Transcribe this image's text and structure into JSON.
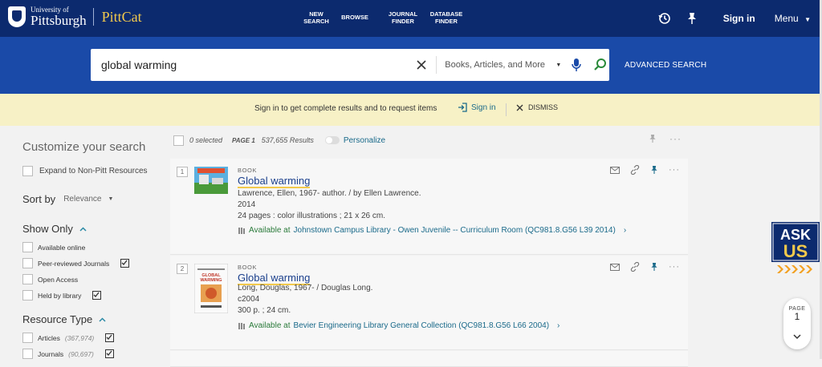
{
  "header": {
    "university_line1": "University of",
    "university_line2": "Pittsburgh",
    "app_name": "PittCat",
    "nav": [
      {
        "l1": "NEW",
        "l2": "SEARCH"
      },
      {
        "l1": "BROWSE",
        "l2": ""
      },
      {
        "l1": "JOURNAL",
        "l2": "FINDER"
      },
      {
        "l1": "DATABASE",
        "l2": "FINDER"
      }
    ],
    "sign_in": "Sign in",
    "menu": "Menu",
    "icons": [
      "history-icon",
      "pin-icon"
    ]
  },
  "search": {
    "query": "global warming",
    "scope": "Books, Articles, and More",
    "advanced": "ADVANCED SEARCH"
  },
  "banner": {
    "text": "Sign in to get complete results and to request items",
    "signin": "Sign in",
    "dismiss": "DISMISS"
  },
  "facets": {
    "title": "Customize your search",
    "expand": "Expand to Non-Pitt Resources",
    "sort_label": "Sort by",
    "sort_value": "Relevance",
    "show_only": "Show Only",
    "show_only_items": [
      "Available online",
      "Peer-reviewed Journals",
      "Open Access",
      "Held by library"
    ],
    "resource_type": "Resource Type",
    "resource_items": [
      {
        "label": "Articles",
        "count": "(367,974)"
      },
      {
        "label": "Journals",
        "count": "(90,697)"
      }
    ]
  },
  "results_toolbar": {
    "selected": "0 selected",
    "page": "PAGE 1",
    "count": "537,655 Results",
    "personalize": "Personalize"
  },
  "results": [
    {
      "num": "1",
      "type": "BOOK",
      "title": "Global warming",
      "author": "Lawrence, Ellen, 1967- author. / by Ellen Lawrence.",
      "date": "2014",
      "desc": "24 pages : color illustrations ; 21 x 26 cm.",
      "avail": "Available at",
      "location": "Johnstown Campus Library - Owen  Juvenile -- Curriculum Room (QC981.8.G56 L39 2014)"
    },
    {
      "num": "2",
      "type": "BOOK",
      "title": "Global warming",
      "author": "Long, Douglas, 1967- / Douglas Long.",
      "date": "c2004",
      "desc": "300 p. ; 24 cm.",
      "avail": "Available at",
      "location": "Bevier Engineering Library  General Collection (QC981.8.G56 L66 2004)",
      "cover_text": "GLOBAL WARMING"
    }
  ],
  "askus": {
    "line1": "ASK",
    "line2": "US"
  },
  "pager": {
    "label": "PAGE",
    "number": "1"
  },
  "colors": {
    "navy": "#0c2a6e",
    "blue": "#1a4aa8",
    "banner": "#f7f1c6",
    "gold": "#f2c94c",
    "teal": "#2a8aa6"
  }
}
